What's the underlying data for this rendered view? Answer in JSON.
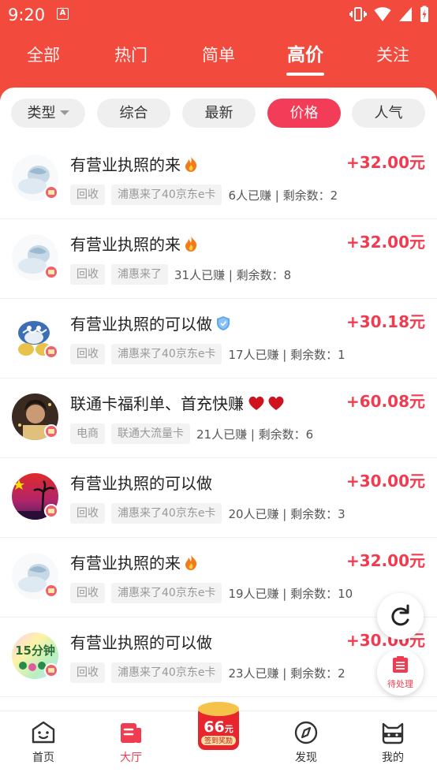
{
  "status_bar": {
    "time": "9:20",
    "app_icon": "A"
  },
  "tabs": [
    {
      "label": "全部"
    },
    {
      "label": "热门"
    },
    {
      "label": "简单"
    },
    {
      "label": "高价",
      "active": true
    },
    {
      "label": "关注"
    }
  ],
  "filters": [
    {
      "label": "类型",
      "dropdown": true
    },
    {
      "label": "综合"
    },
    {
      "label": "最新"
    },
    {
      "label": "价格",
      "active": true
    },
    {
      "label": "人气"
    }
  ],
  "tasks": [
    {
      "title": "有营业执照的来",
      "emoji": "fire",
      "price": "+32.00元",
      "tags": [
        "回收",
        "浦惠来了40京东e卡"
      ],
      "stats": "6人已赚 | 剩余数：2"
    },
    {
      "title": "有营业执照的来",
      "emoji": "fire",
      "price": "+32.00元",
      "tags": [
        "回收",
        "浦惠来了"
      ],
      "stats": "31人已赚 | 剩余数：8"
    },
    {
      "title": "有营业执照的可以做",
      "emoji": "shield",
      "price": "+30.18元",
      "tags": [
        "回收",
        "浦惠来了40京东e卡"
      ],
      "stats": "17人已赚 | 剩余数：1"
    },
    {
      "title": "联通卡福利单、首充快赚",
      "emoji": "hearts",
      "price": "+60.08元",
      "tags": [
        "电商",
        "联通大流量卡"
      ],
      "stats": "21人已赚 | 剩余数：6"
    },
    {
      "title": "有营业执照的可以做",
      "emoji": "",
      "price": "+30.00元",
      "tags": [
        "回收",
        "浦惠来了40京东e卡"
      ],
      "stats": "20人已赚 | 剩余数：3"
    },
    {
      "title": "有营业执照的来",
      "emoji": "fire",
      "price": "+32.00元",
      "tags": [
        "回收",
        "浦惠来了40京东e卡"
      ],
      "stats": "19人已赚 | 剩余数：10"
    },
    {
      "title": "有营业执照的可以做",
      "emoji": "",
      "price": "+30.00元",
      "tags": [
        "回收",
        "浦惠来了40京东e卡"
      ],
      "stats": "23人已赚 | 剩余数：2"
    }
  ],
  "fabs": {
    "pending_label": "待处理"
  },
  "promo": {
    "amount": "66",
    "unit": "元",
    "caption": "签到奖励"
  },
  "bottom_nav": [
    {
      "label": "首页",
      "icon": "home-face-icon"
    },
    {
      "label": "大厅",
      "icon": "hall-icon",
      "active": true
    },
    {
      "label": "发现",
      "icon": "compass-icon"
    },
    {
      "label": "我的",
      "icon": "cat-face-icon"
    }
  ],
  "colors": {
    "header": "#f24b3e",
    "accent": "#f03c50",
    "chip_active": "#f23c58"
  }
}
